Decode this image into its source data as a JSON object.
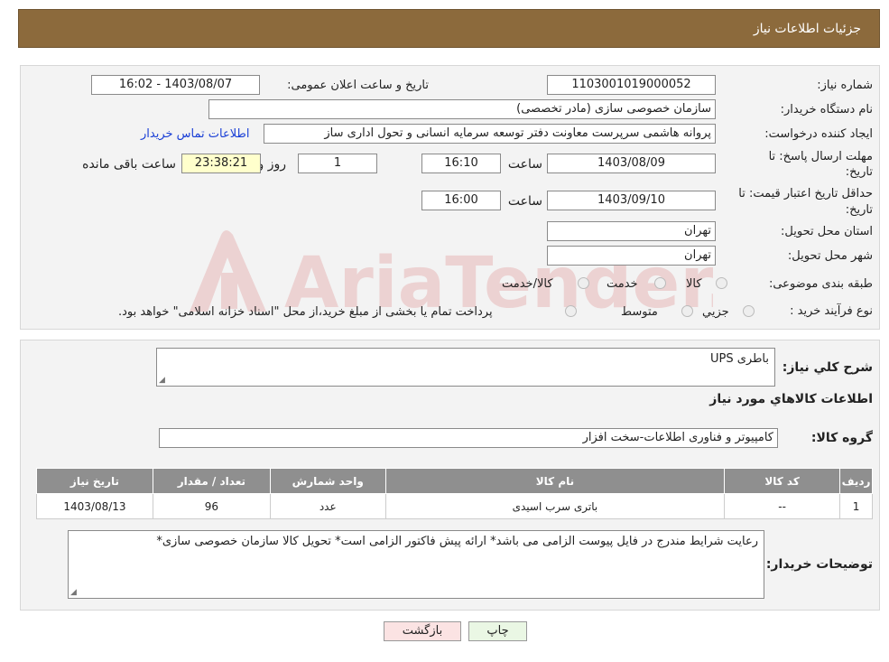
{
  "header": {
    "title": "جزئیات اطلاعات نیاز"
  },
  "form": {
    "need_number_label": "شماره نیاز:",
    "need_number": "1103001019000052",
    "announce_label": "تاریخ و ساعت اعلان عمومی:",
    "announce_value": "1403/08/07 - 16:02",
    "buyer_org_label": "نام دستگاه خریدار:",
    "buyer_org": "سازمان خصوصی سازی (مادر تخصصی)",
    "creator_label": "ایجاد کننده درخواست:",
    "creator": "پروانه هاشمی سرپرست معاونت دفتر توسعه سرمایه انسانی و تحول اداری ساز",
    "contact_link": "اطلاعات تماس خریدار",
    "deadline_label_1": "مهلت ارسال پاسخ: تا",
    "deadline_label_2": "تاریخ:",
    "deadline_date": "1403/08/09",
    "time_label": "ساعت",
    "deadline_time": "16:10",
    "days_value": "1",
    "days_label": "روز و",
    "remaining_time": "23:38:21",
    "remaining_label": "ساعت باقی مانده",
    "validity_label_1": "حداقل تاریخ اعتبار قیمت: تا",
    "validity_label_2": "تاریخ:",
    "validity_date": "1403/09/10",
    "validity_time": "16:00",
    "province_label": "استان محل تحویل:",
    "province": "تهران",
    "city_label": "شهر محل تحویل:",
    "city": "تهران",
    "category_label": "طبقه بندی موضوعی:",
    "category_options": [
      "کالا",
      "خدمت",
      "کالا/خدمت"
    ],
    "process_label": "نوع فرآیند خرید :",
    "process_options": [
      "جزیي",
      "متوسط"
    ],
    "process_note": "پرداخت تمام یا بخشی از مبلغ خرید،از محل \"اسناد خزانه اسلامی\" خواهد بود."
  },
  "detail": {
    "summary_label": "شرح کلي نياز:",
    "summary": "باطری UPS",
    "goods_info_title": "اطلاعات کالاهاي مورد نياز",
    "group_label": "گروه کالا:",
    "group_value": "کامپیوتر و فناوری اطلاعات-سخت افزار",
    "table": {
      "columns": [
        "رديف",
        "کد کالا",
        "نام کالا",
        "واحد شمارش",
        "تعداد / مقدار",
        "تاریخ نیاز"
      ],
      "rows": [
        [
          "1",
          "--",
          "باتری سرب اسیدی",
          "عدد",
          "96",
          "1403/08/13"
        ]
      ]
    },
    "buyer_notes_label": "توضيحات خريدار:",
    "buyer_notes": "رعایت شرایط مندرج در فایل پیوست الزامی می باشد* ارائه پیش فاکتور الزامی است* تحویل کالا سازمان خصوصی سازی*"
  },
  "buttons": {
    "print": "چاپ",
    "back": "بازگشت"
  },
  "watermark": {
    "text": "AriaTender.neT"
  }
}
